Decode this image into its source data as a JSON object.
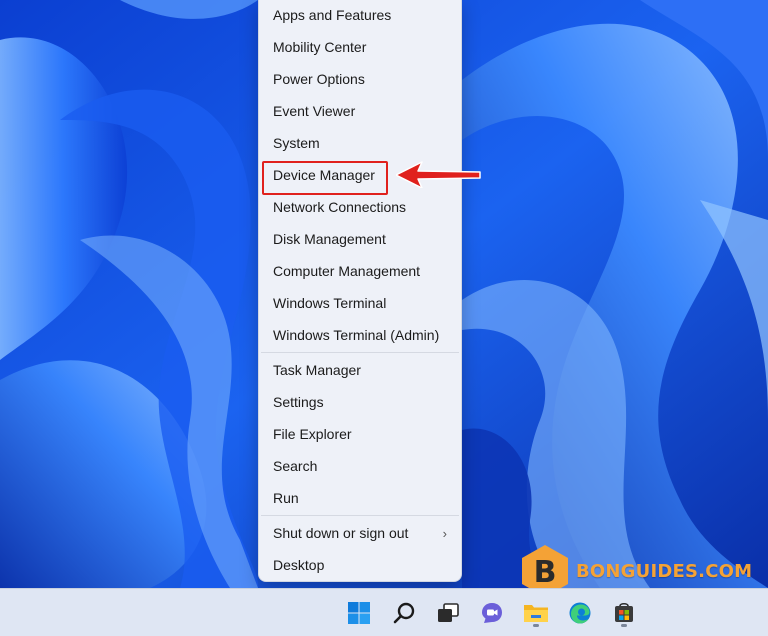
{
  "context_menu": {
    "items": [
      {
        "label": "Apps and Features"
      },
      {
        "label": "Mobility Center"
      },
      {
        "label": "Power Options"
      },
      {
        "label": "Event Viewer"
      },
      {
        "label": "System"
      },
      {
        "label": "Device Manager",
        "highlighted": true
      },
      {
        "label": "Network Connections"
      },
      {
        "label": "Disk Management"
      },
      {
        "label": "Computer Management"
      },
      {
        "label": "Windows Terminal"
      },
      {
        "label": "Windows Terminal (Admin)"
      },
      {
        "label": "Task Manager"
      },
      {
        "label": "Settings"
      },
      {
        "label": "File Explorer"
      },
      {
        "label": "Search"
      },
      {
        "label": "Run"
      },
      {
        "label": "Shut down or sign out",
        "has_submenu": true
      },
      {
        "label": "Desktop"
      }
    ],
    "submenu_chevron": "›"
  },
  "watermark": {
    "letter": "B",
    "text": "BONGUIDES.COM"
  },
  "taskbar": {
    "icons": [
      "windows-start-icon",
      "search-icon",
      "task-view-icon",
      "chat-icon",
      "file-explorer-icon",
      "edge-icon",
      "store-icon"
    ]
  },
  "colors": {
    "menu_bg": "#eef1f8",
    "highlight_border": "#e0211d",
    "arrow": "#e0211d",
    "watermark": "#f4a236",
    "taskbar_bg": "#dfe6f3"
  }
}
